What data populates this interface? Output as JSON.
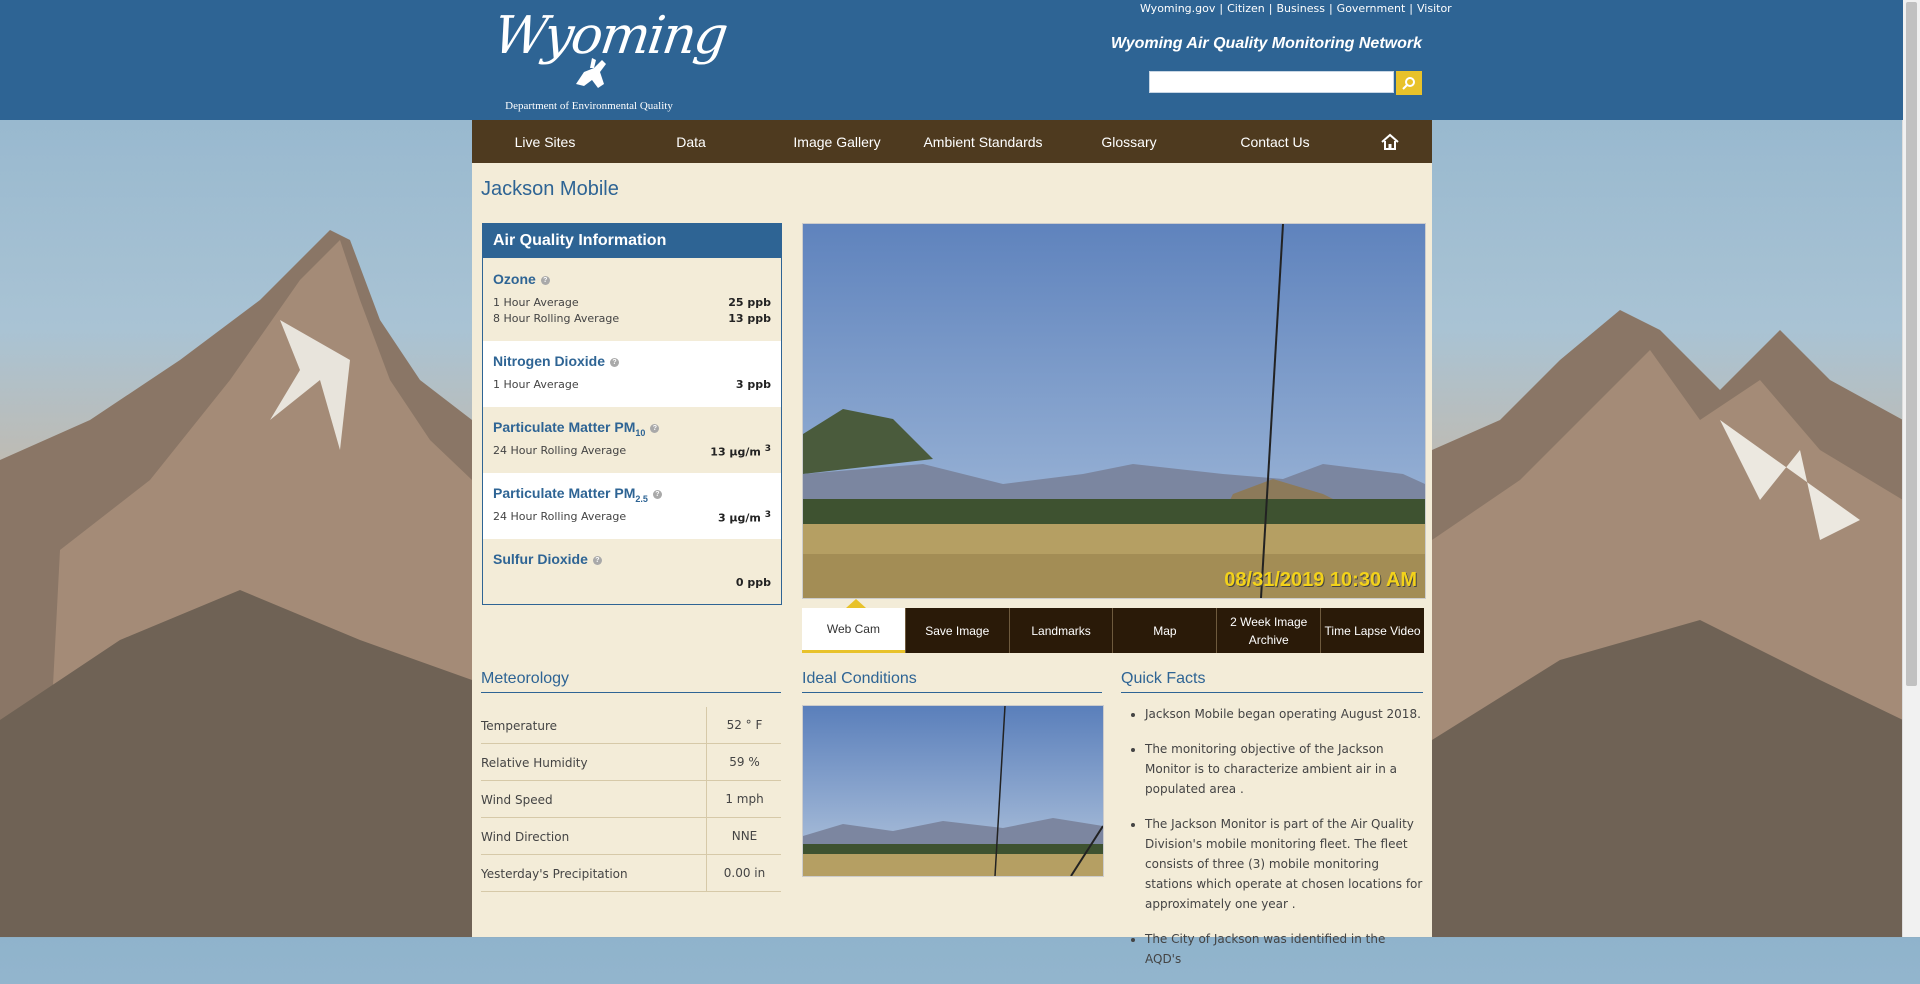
{
  "header": {
    "logo_script": "Wyoming",
    "logo_dept": "Department of Environmental Quality",
    "top_links": [
      "Wyoming.gov",
      "Citizen",
      "Business",
      "Government",
      "Visitor"
    ],
    "site_title": "Wyoming Air Quality Monitoring Network",
    "search": {
      "value": "",
      "placeholder": ""
    }
  },
  "nav": {
    "items": [
      "Live Sites",
      "Data",
      "Image Gallery",
      "Ambient Standards",
      "Glossary",
      "Contact Us"
    ],
    "home_icon": "home-icon"
  },
  "page": {
    "title": "Jackson Mobile"
  },
  "air_quality": {
    "heading": "Air Quality Information",
    "ozone": {
      "name": "Ozone",
      "rows": [
        {
          "label": "1 Hour Average",
          "value": "25 ppb"
        },
        {
          "label": "8 Hour Rolling Average",
          "value": "13 ppb"
        }
      ]
    },
    "no2": {
      "name": "Nitrogen Dioxide",
      "rows": [
        {
          "label": "1 Hour Average",
          "value": "3 ppb"
        }
      ]
    },
    "pm10": {
      "name": "Particulate Matter PM",
      "sub": "10",
      "label": "24 Hour Rolling Average",
      "value": "13 µg/m",
      "sup": "3"
    },
    "pm25": {
      "name": "Particulate Matter PM",
      "sub": "2.5",
      "label": "24 Hour Rolling Average",
      "value": "3 µg/m",
      "sup": "3"
    },
    "so2": {
      "name": "Sulfur Dioxide",
      "value": "0 ppb"
    },
    "help_glyph": "?"
  },
  "webcam": {
    "timestamp": "08/31/2019 10:30 AM",
    "tabs": [
      "Web Cam",
      "Save Image",
      "Landmarks",
      "Map",
      "2 Week Image Archive",
      "Time Lapse Video"
    ],
    "active_tab": "Web Cam"
  },
  "meteorology": {
    "heading": "Meteorology",
    "rows": [
      {
        "label": "Temperature",
        "value": "52 ° F"
      },
      {
        "label": "Relative Humidity",
        "value": "59 %"
      },
      {
        "label": "Wind Speed",
        "value": "1 mph"
      },
      {
        "label": "Wind Direction",
        "value": "NNE"
      },
      {
        "label": "Yesterday's Precipitation",
        "value": "0.00 in"
      }
    ]
  },
  "ideal": {
    "heading": "Ideal Conditions"
  },
  "quick_facts": {
    "heading": "Quick Facts",
    "items": [
      "Jackson Mobile began operating August 2018.",
      "The monitoring objective of the Jackson Monitor is to characterize ambient air in a populated area .",
      "The Jackson Monitor is part of the Air Quality Division's mobile monitoring fleet. The fleet consists of three (3) mobile monitoring stations which operate at chosen locations for approximately one year .",
      "The City of Jackson was identified in the AQD's"
    ]
  },
  "colors": {
    "header_blue": "#2e6494",
    "nav_brown": "#4e3a1f",
    "panel_cream": "#f3ecd8",
    "accent_yellow": "#e8c22a"
  }
}
